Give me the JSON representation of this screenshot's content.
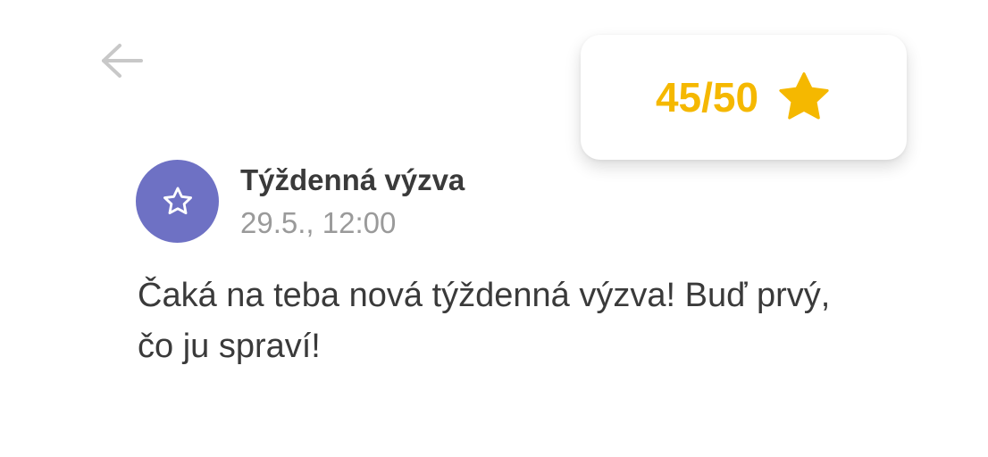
{
  "header": {
    "back_icon": "arrow-left-icon",
    "back_color": "#C8C8C8"
  },
  "score": {
    "text": "45/50",
    "icon": "star-filled-icon",
    "color": "#F5B800"
  },
  "notification": {
    "icon": "star-outline-icon",
    "avatar_color": "#6E71C4",
    "title": "Týždenná výzva",
    "timestamp": "29.5., 12:00",
    "message": "Čaká na teba nová týždenná výzva! Buď prvý, čo ju spraví!"
  }
}
